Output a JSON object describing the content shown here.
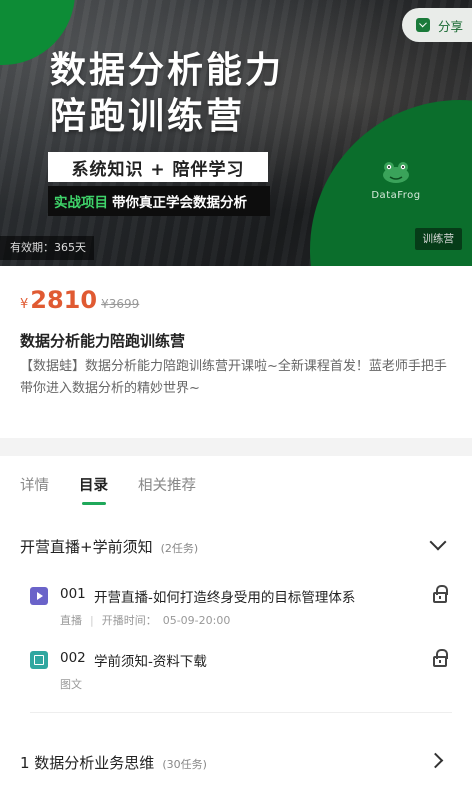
{
  "banner": {
    "title_line1": "数据分析能力",
    "title_line2": "陪跑训练营",
    "tagline": "系统知识 + 陪伴学习",
    "strip_highlight": "实战项目",
    "strip_text": "带你真正学会数据分析",
    "logo_text": "DataFrog",
    "validity": "有效期：365天",
    "type_tag": "训练营"
  },
  "share": {
    "label": "分享",
    "icon": "share-icon"
  },
  "price": {
    "currency": "¥",
    "current": "2810",
    "original": "¥3699",
    "color": "#e05a32"
  },
  "course": {
    "title": "数据分析能力陪跑训练营",
    "description": "【数据蛙】数据分析能力陪跑训练营开课啦~全新课程首发！蓝老师手把手带你进入数据分析的精妙世界~"
  },
  "tabs": [
    {
      "label": "详情",
      "active": false
    },
    {
      "label": "目录",
      "active": true
    },
    {
      "label": "相关推荐",
      "active": false
    }
  ],
  "accent_color": "#1fa85a",
  "sections": [
    {
      "name": "开营直播+学前须知",
      "count": "(2任务)",
      "expanded": true,
      "lessons": [
        {
          "num": "001",
          "title": "开营直播-如何打造终身受用的目标管理体系",
          "type": "直播",
          "meta_label": "开播时间：",
          "meta_value": "05-09-20:00",
          "icon": "video-icon",
          "locked": true
        },
        {
          "num": "002",
          "title": "学前须知-资料下载",
          "type": "图文",
          "icon": "doc-icon",
          "locked": true
        }
      ]
    },
    {
      "name": "1 数据分析业务思维",
      "count": "(30任务)",
      "expanded": false
    }
  ]
}
